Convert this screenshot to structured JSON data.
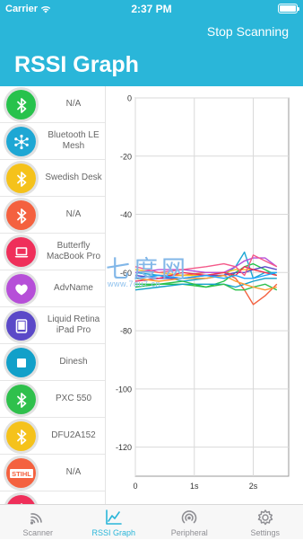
{
  "status_bar": {
    "carrier": "Carrier",
    "time": "2:37 PM"
  },
  "nav": {
    "action_label": "Stop Scanning",
    "title": "RSSI Graph"
  },
  "devices": [
    {
      "name": "N/A",
      "color": "#27c24c",
      "icon": "bluetooth-icon"
    },
    {
      "name": "Bluetooth LE Mesh",
      "color": "#1ea7d4",
      "icon": "mesh-network-icon"
    },
    {
      "name": "Swedish Desk",
      "color": "#f5c21b",
      "icon": "bluetooth-icon"
    },
    {
      "name": "N/A",
      "color": "#f4613f",
      "icon": "bluetooth-icon"
    },
    {
      "name": "Butterfly MacBook Pro",
      "color": "#ef2f5a",
      "icon": "laptop-icon"
    },
    {
      "name": "AdvName",
      "color": "#b64fd8",
      "icon": "heart-icon"
    },
    {
      "name": "Liquid Retina iPad Pro",
      "color": "#5b49c8",
      "icon": "tablet-icon"
    },
    {
      "name": "Dinesh",
      "color": "#12a0c9",
      "icon": "square-icon"
    },
    {
      "name": "PXC 550",
      "color": "#2fc04c",
      "icon": "bluetooth-icon"
    },
    {
      "name": "DFU2A152",
      "color": "#f5c21b",
      "icon": "bluetooth-icon"
    },
    {
      "name": "N/A",
      "color": "#f4613f",
      "icon": "stihl-logo-icon",
      "logo_text": "STIHL"
    },
    {
      "name": "",
      "color": "#ef2f5a",
      "icon": "bluetooth-icon"
    }
  ],
  "chart_data": {
    "type": "line",
    "x_tick_labels": [
      "0",
      "1s",
      "2s"
    ],
    "y_tick_labels": [
      "0",
      "-20",
      "-40",
      "-60",
      "-80",
      "-100",
      "-120"
    ],
    "xlim": [
      0,
      2.6
    ],
    "ylim": [
      -130,
      0
    ],
    "grid": true,
    "x": [
      0.0,
      0.4,
      0.8,
      1.2,
      1.5,
      1.7,
      1.85,
      2.0,
      2.2,
      2.4
    ],
    "series": [
      {
        "color": "#f4613f",
        "values": [
          -62,
          -61,
          -61,
          -60,
          -60,
          -62,
          -66,
          -71,
          -68,
          -64
        ]
      },
      {
        "color": "#27c24c",
        "values": [
          -64,
          -64,
          -64,
          -65,
          -63,
          -60,
          -58,
          -57,
          -59,
          -61
        ]
      },
      {
        "color": "#1ea7d4",
        "values": [
          -60,
          -61,
          -63,
          -62,
          -61,
          -58,
          -53,
          -62,
          -60,
          -60
        ]
      },
      {
        "color": "#f5c21b",
        "values": [
          -59,
          -60,
          -61,
          -61,
          -60,
          -59,
          -59,
          -59,
          -60,
          -61
        ]
      },
      {
        "color": "#b64fd8",
        "values": [
          -60,
          -59,
          -59,
          -60,
          -60,
          -58,
          -56,
          -55,
          -55,
          -58
        ]
      },
      {
        "color": "#5b49c8",
        "values": [
          -61,
          -62,
          -62,
          -61,
          -61,
          -60,
          -60,
          -59,
          -58,
          -59
        ]
      },
      {
        "color": "#ef2f5a",
        "values": [
          -63,
          -62,
          -60,
          -61,
          -60,
          -61,
          -58,
          -59,
          -60,
          -61
        ]
      },
      {
        "color": "#12a0c9",
        "values": [
          -66,
          -65,
          -64,
          -64,
          -64,
          -65,
          -64,
          -63,
          -62,
          -62
        ]
      },
      {
        "color": "#2fc04c",
        "values": [
          -65,
          -64,
          -63,
          -65,
          -64,
          -66,
          -66,
          -65,
          -64,
          -66
        ]
      },
      {
        "color": "#ff9a2f",
        "values": [
          -62,
          -63,
          -62,
          -62,
          -61,
          -63,
          -64,
          -65,
          -66,
          -65
        ]
      },
      {
        "color": "#f45a8a",
        "values": [
          -58,
          -60,
          -59,
          -58,
          -57,
          -58,
          -61,
          -54,
          -56,
          -58
        ]
      },
      {
        "color": "#1da4ff",
        "values": [
          -62,
          -61,
          -62,
          -61,
          -62,
          -61,
          -62,
          -62,
          -61,
          -60
        ]
      }
    ]
  },
  "watermark": {
    "chinese": "七度网",
    "url": "www.7du7.cn"
  },
  "tabs": [
    {
      "label": "Scanner",
      "icon": "scanner-icon",
      "active": false
    },
    {
      "label": "RSSI Graph",
      "icon": "graph-icon",
      "active": true
    },
    {
      "label": "Peripheral",
      "icon": "peripheral-icon",
      "active": false
    },
    {
      "label": "Settings",
      "icon": "gear-icon",
      "active": false
    }
  ]
}
